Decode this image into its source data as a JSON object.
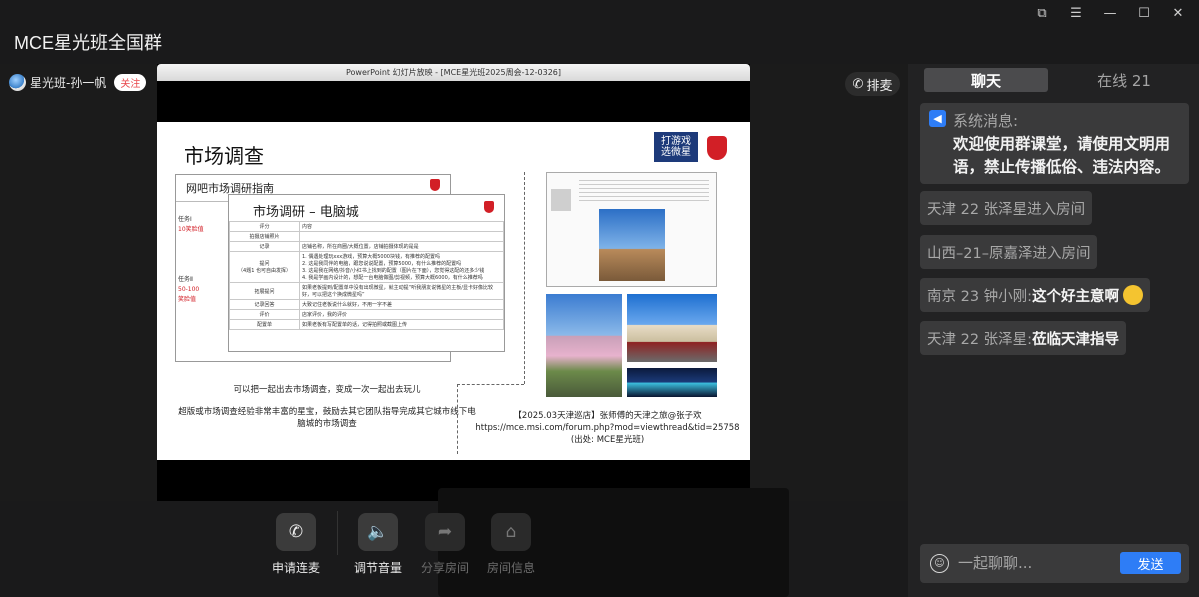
{
  "window": {
    "title": "MCE星光班全国群",
    "controls": [
      "pin-icon",
      "menu-icon",
      "minimize-icon",
      "maximize-icon",
      "close-icon"
    ]
  },
  "host": {
    "name": "星光班-孙一帆",
    "follow_label": "关注"
  },
  "queue_label": "排麦",
  "share": {
    "window_title": "PowerPoint 幻灯片放映 - [MCE星光班2025周会-12-0326]",
    "slide": {
      "title": "市场调查",
      "logo_text": "打游戏\n选微星",
      "doc1_title": "网吧市场调研指南",
      "doc1_side": [
        "任务Ⅰ",
        "10笑脸值",
        "任务Ⅱ",
        "50-100",
        "笑脸值"
      ],
      "doc2_title": "市场调研 – 电脑城",
      "table": [
        [
          "评分",
          "内容"
        ],
        [
          "拍摄店铺照片",
          ""
        ],
        [
          "记录",
          "店铺名称，所在商圈/大概位置，店铺拍摄体现的是是"
        ],
        [
          "提问\n（4题1 也可自由发挥）",
          "1. 偶遇处理玩xxx游戏，预算大概5000块钱，有推荐的配置吗\n2. 这是我同伴的电脑，跟您说说配置，预算5000，有什么推荐的配置吗\n3. 这是我在网络/抖音/小红书上找到的配置（图片在下面），您觉得这配的还多少钱\n4. 我是学画内设计的，想配一台电脑做图/剪视频，预算大概6000，有什么推荐吗"
        ],
        [
          "拓展提问",
          "如果老板提到/配置单中没有出现微星，就主动提“听我朋友说微星的主板/显卡好像比较好，可以把这个换成微星吗”"
        ],
        [
          "记录回答",
          "大致记住老板说什么就好，不用一字不差"
        ],
        [
          "评价",
          "店家评价，我的评价"
        ],
        [
          "配置单",
          "如果老板有写配置单的话，记得拍照或截图上传"
        ]
      ],
      "caption_left": [
        "可以把一起出去市场调查，变成一次一起出去玩儿",
        "超版或市场调查经验非常丰富的星宝，鼓励去其它团队指导完成其它城市线下电脑城的市场调查"
      ],
      "caption_right": [
        "【2025.03天津巡店】张师傅的天津之旅@张子欢",
        "https://mce.msi.com/forum.php?mod=viewthread&tid=25758",
        "(出处: MCE星光班)"
      ]
    }
  },
  "toolbar": [
    {
      "label": "申请连麦",
      "icon": "phone-icon",
      "enabled": true
    },
    {
      "label": "调节音量",
      "icon": "speaker-icon",
      "enabled": true
    },
    {
      "label": "分享房间",
      "icon": "share-icon",
      "enabled": false
    },
    {
      "label": "房间信息",
      "icon": "home-info-icon",
      "enabled": false
    }
  ],
  "chat": {
    "tab_chat": "聊天",
    "tab_online": "在线 21",
    "system": {
      "head": "系统消息:",
      "body": "欢迎使用群课堂，请使用文明用语，禁止传播低俗、违法内容。"
    },
    "messages": [
      {
        "user": "天津 22 张泽星",
        "text": " 进入房间",
        "bold": false
      },
      {
        "user": "山西–21–原嘉泽",
        "text": " 进入房间",
        "bold": false
      },
      {
        "user": "南京 23 钟小刚: ",
        "text": "这个好主意啊",
        "bold": true,
        "emoji": "thinking-emoji"
      },
      {
        "user": "天津 22 张泽星: ",
        "text": "莅临天津指导",
        "bold": true
      }
    ],
    "input_placeholder": "一起聊聊...",
    "send_label": "发送"
  }
}
